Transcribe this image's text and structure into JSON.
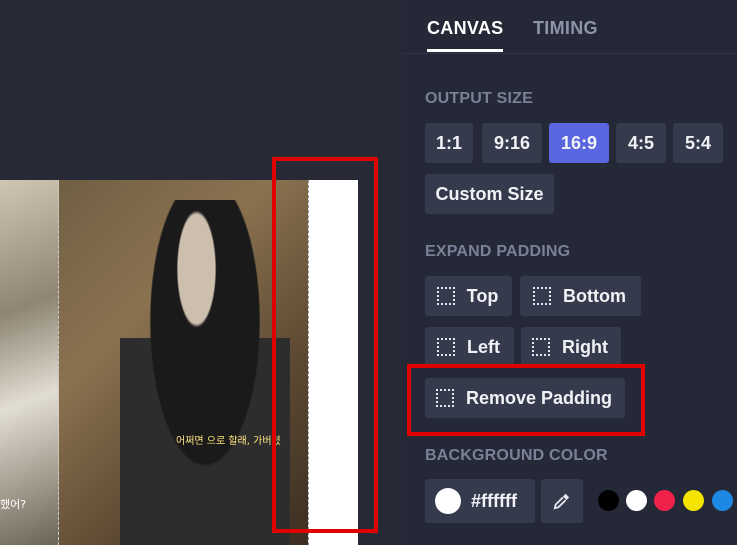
{
  "tabs": [
    {
      "label": "CANVAS",
      "active": true
    },
    {
      "label": "TIMING",
      "active": false
    }
  ],
  "output_size": {
    "title": "OUTPUT SIZE",
    "options": [
      "1:1",
      "9:16",
      "16:9",
      "4:5",
      "5:4"
    ],
    "selected": "16:9",
    "custom_label": "Custom Size"
  },
  "expand_padding": {
    "title": "EXPAND PADDING",
    "top": "Top",
    "bottom": "Bottom",
    "left": "Left",
    "right": "Right",
    "remove": "Remove Padding"
  },
  "background_color": {
    "title": "BACKGROUND COLOR",
    "value": "#ffffff",
    "swatches": [
      "#000000",
      "#ffffff",
      "#f0224c",
      "#f5e400",
      "#1e88e5"
    ]
  },
  "preview": {
    "subtitle_center": "어쩌면 으로 할래, 가버렸",
    "subtitle_left": "했어?"
  },
  "colors": {
    "accent": "#5a66e0",
    "annotation": "#e00000"
  }
}
